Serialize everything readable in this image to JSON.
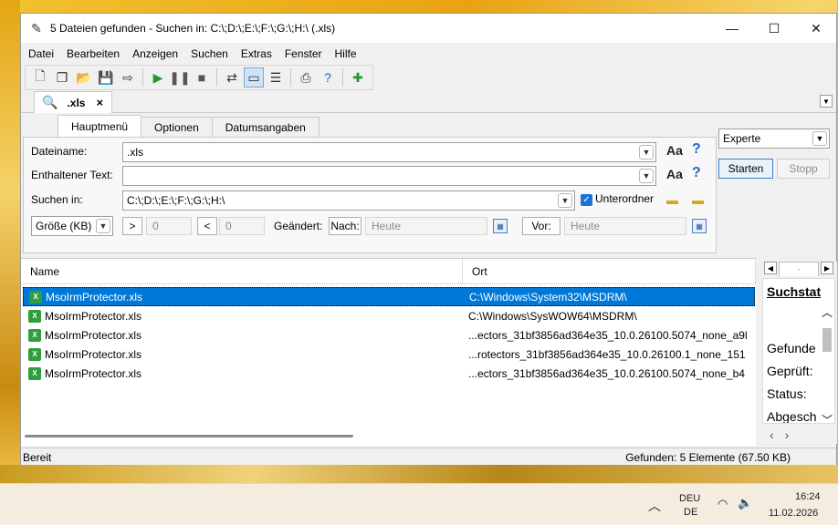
{
  "window": {
    "title": "5 Dateien gefunden - Suchen in: C:\\;D:\\;E:\\;F:\\;G:\\;H:\\ (.xls)",
    "minimize": "—",
    "maximize": "☐",
    "close": "✕"
  },
  "menu": [
    "Datei",
    "Bearbeiten",
    "Anzeigen",
    "Suchen",
    "Extras",
    "Fenster",
    "Hilfe"
  ],
  "doc_tab": {
    "label": ".xls",
    "close": "×"
  },
  "inner_tabs": [
    "Hauptmenü",
    "Optionen",
    "Datumsangaben"
  ],
  "form": {
    "filename_label": "Dateiname:",
    "filename_value": ".xls",
    "text_label": "Enthaltener Text:",
    "text_value": "",
    "search_in_label": "Suchen in:",
    "search_in_value": "C:\\;D:\\;E:\\;F:\\;G:\\;H:\\",
    "subfolders_label": "Unterordner",
    "size_select": "Größe (KB)",
    "gt_label": ">",
    "gt_value": "0",
    "lt_label": "<",
    "lt_value": "0",
    "changed_label": "Geändert:",
    "after_label": "Nach:",
    "after_value": "Heute",
    "before_label": "Vor:",
    "before_value": "Heute",
    "case_glyph": "Aa",
    "help_glyph": "?"
  },
  "side": {
    "mode": "Experte",
    "start_label": "Starten",
    "stop_label": "Stopp"
  },
  "results": {
    "columns": [
      "Name",
      "Ort"
    ],
    "rows": [
      {
        "name": "MsoIrmProtector.xls",
        "location": "C:\\Windows\\System32\\MSDRM\\"
      },
      {
        "name": "MsoIrmProtector.xls",
        "location": "C:\\Windows\\SysWOW64\\MSDRM\\"
      },
      {
        "name": "MsoIrmProtector.xls",
        "location": "...ectors_31bf3856ad364e35_10.0.26100.5074_none_a9l"
      },
      {
        "name": "MsoIrmProtector.xls",
        "location": "...rotectors_31bf3856ad364e35_10.0.26100.1_none_151"
      },
      {
        "name": "MsoIrmProtector.xls",
        "location": "...ectors_31bf3856ad364e35_10.0.26100.5074_none_b4"
      }
    ]
  },
  "status_panel": {
    "title": "Suchstat",
    "lines": [
      "Gefunde",
      "Geprüft:",
      "Status:",
      "Abgesch"
    ]
  },
  "statusbar": {
    "left": "Bereit",
    "right": "Gefunden: 5 Elemente (67.50 KB)"
  },
  "taskbar": {
    "lang_top": "DEU",
    "lang_bottom": "DE",
    "time": "16:24",
    "date": "11.02.2026"
  }
}
